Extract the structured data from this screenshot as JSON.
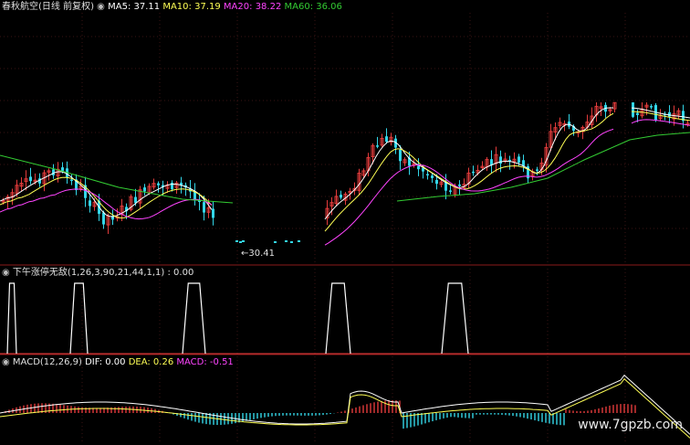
{
  "colors": {
    "up": "#e23b3b",
    "down": "#33d6e8",
    "ma5": "#ffffff",
    "ma10": "#ffff55",
    "ma20": "#ff44ff",
    "ma60": "#33cc33",
    "text": "#e0e0e0",
    "divider": "#8b1a1a"
  },
  "watermark": "www.7gpzb.com",
  "chart_data": [
    {
      "type": "candlestick",
      "title": "春秋航空(日线 前复权)",
      "legend": [
        {
          "name": "MA5",
          "value": "37.11",
          "color": "#ffffff"
        },
        {
          "name": "MA10",
          "value": "37.19",
          "color": "#ffff55"
        },
        {
          "name": "MA20",
          "value": "38.22",
          "color": "#ff44ff"
        },
        {
          "name": "MA60",
          "value": "36.06",
          "color": "#33cc33"
        }
      ],
      "low_annotation": "30.41",
      "ylim": [
        30,
        48
      ]
    },
    {
      "type": "line",
      "title": "下午涨停无敌(1,26,3,90,21,44,1,1) : 0.00",
      "pulses": [
        [
          8,
          18
        ],
        [
          77,
          96
        ],
        [
          200,
          225
        ],
        [
          357,
          384
        ],
        [
          484,
          513
        ]
      ],
      "ylim": [
        0,
        1
      ]
    },
    {
      "type": "bar",
      "title_parts": [
        {
          "text": "MACD(12,26,9)",
          "color": "#e0e0e0"
        },
        {
          "text": "DIF: 0.00",
          "color": "#ffffff"
        },
        {
          "text": "DEA: 0.26",
          "color": "#ffff55"
        },
        {
          "text": "MACD: -0.51",
          "color": "#ff44ff"
        }
      ]
    }
  ]
}
